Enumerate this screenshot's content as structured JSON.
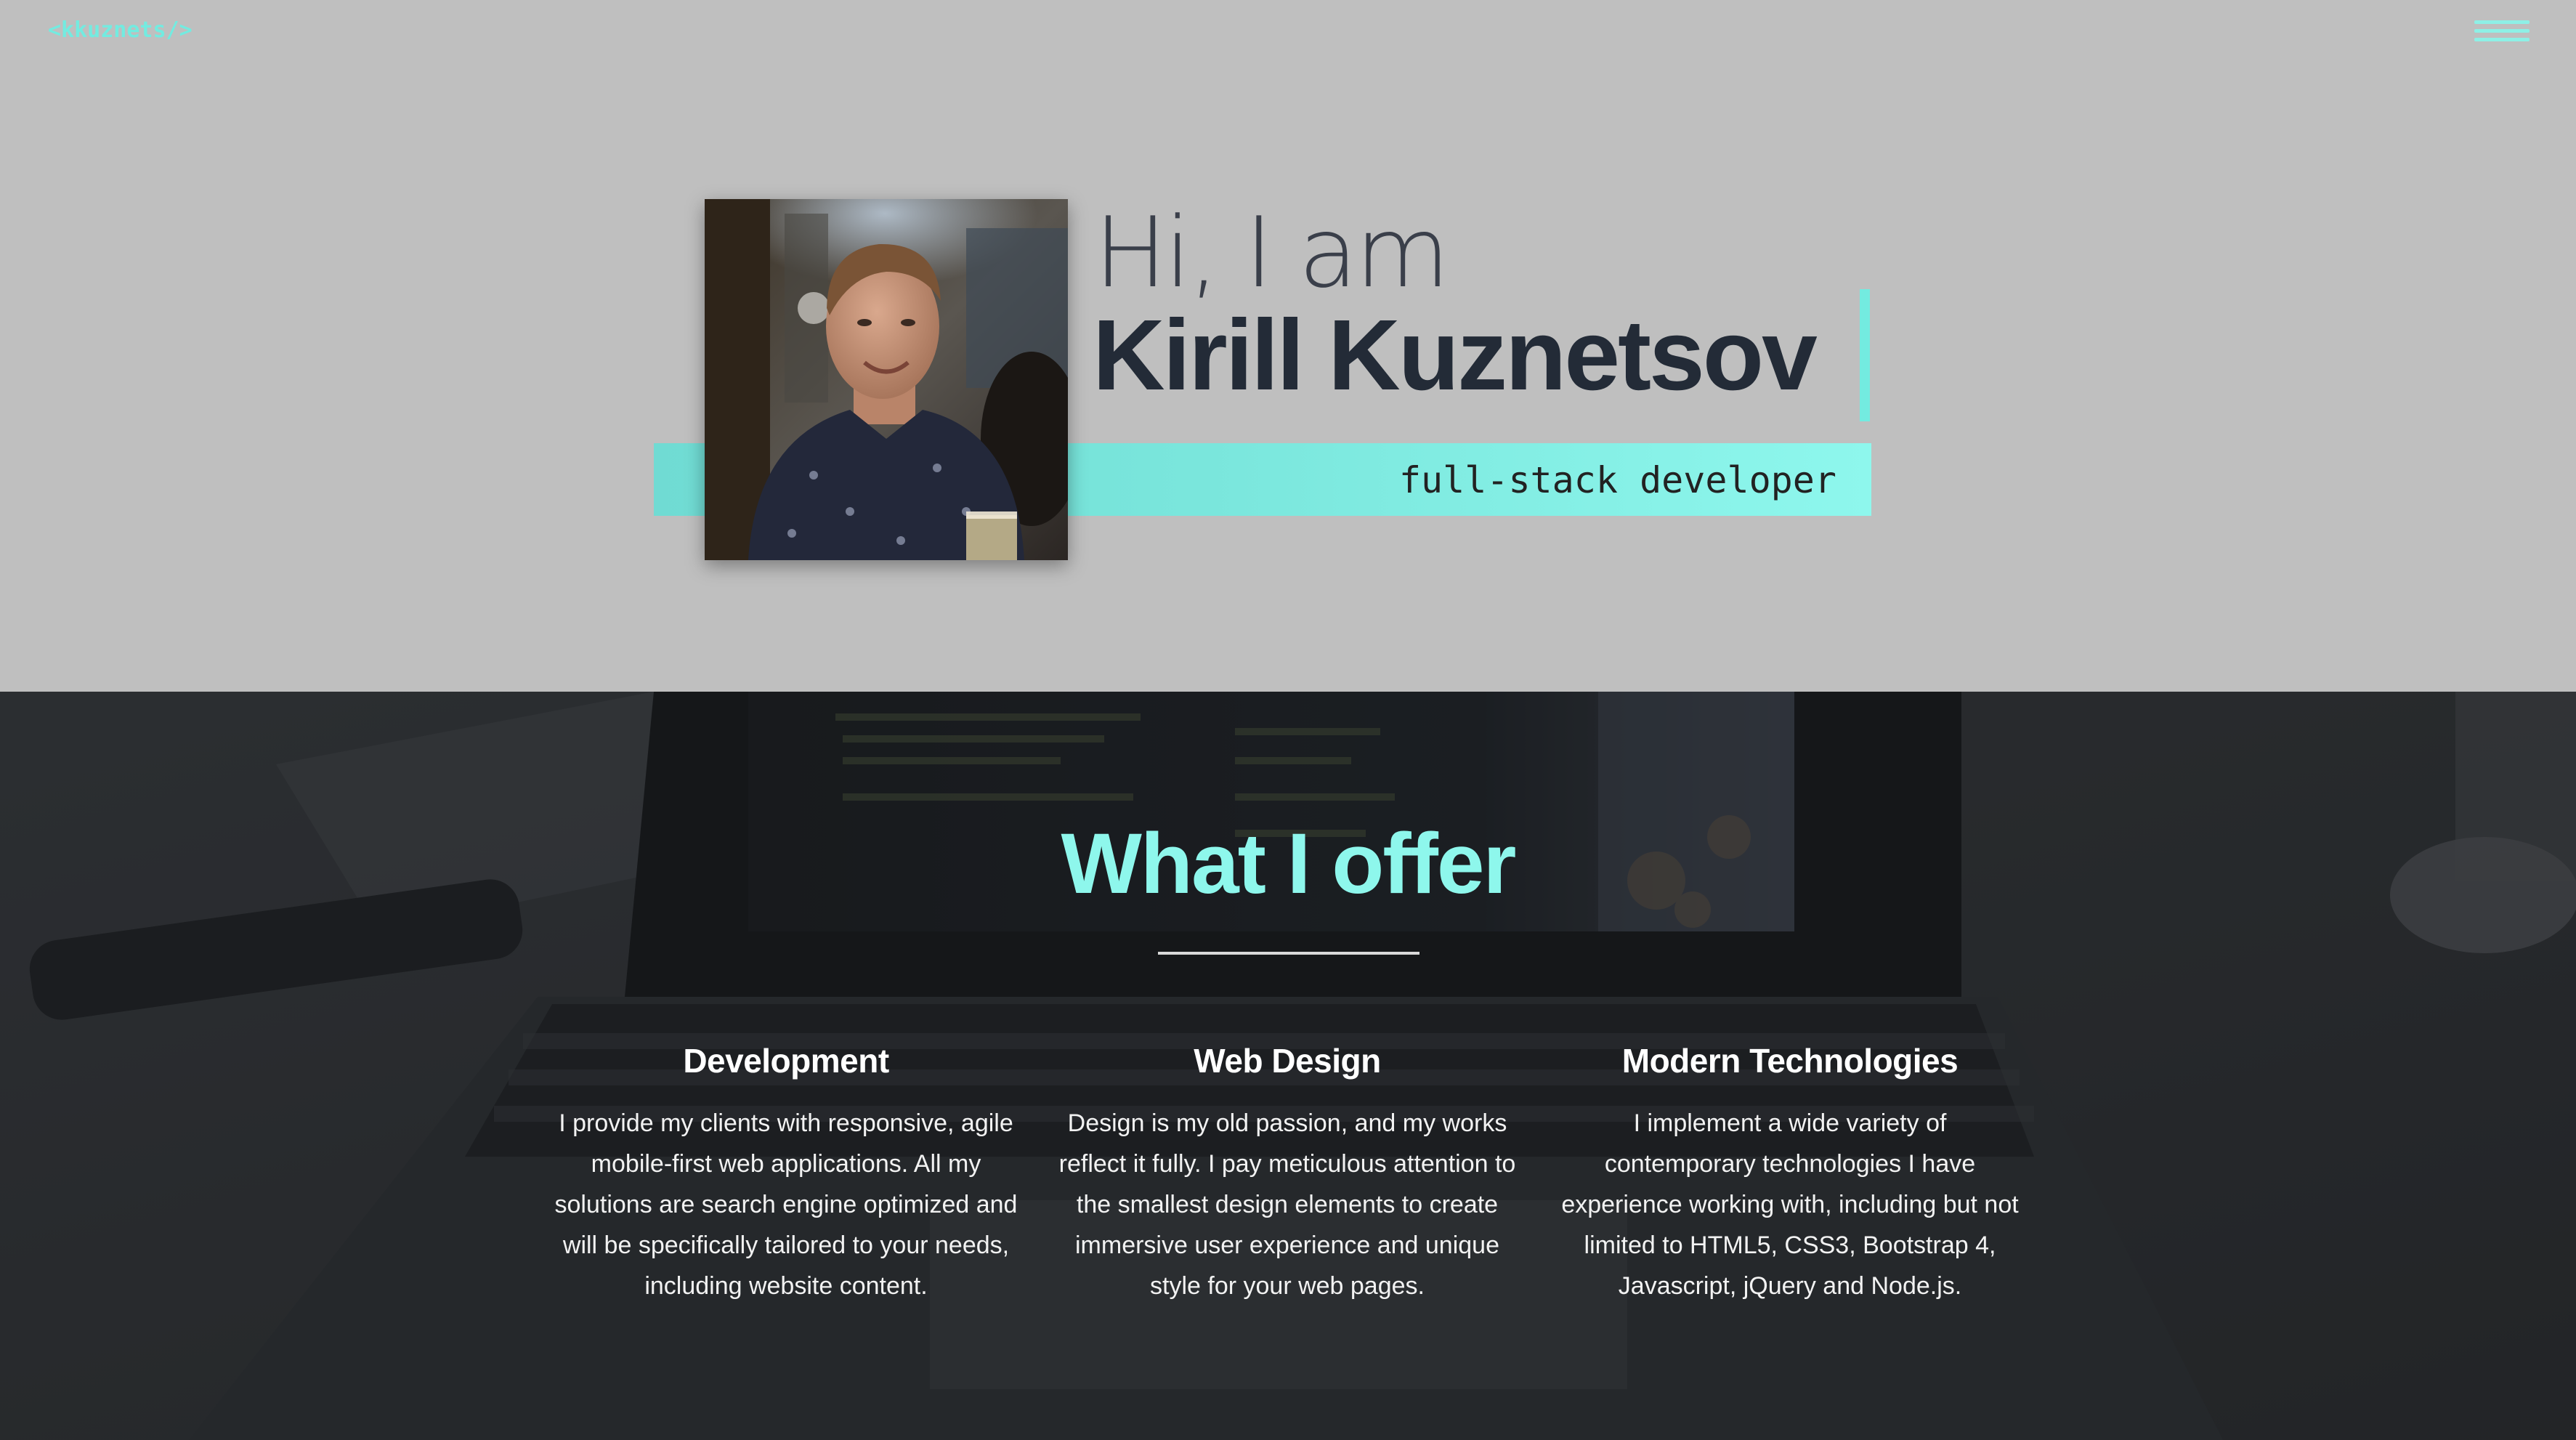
{
  "header": {
    "logo": "<kkuznets/>",
    "menu_icon": "hamburger-menu-icon"
  },
  "hero": {
    "greeting": "Hi, I am",
    "name": "Kirill Kuznetsov",
    "subtitle": "full-stack developer"
  },
  "offer": {
    "title": "What I offer",
    "columns": [
      {
        "heading": "Development",
        "text": "I provide my clients with responsive, agile mobile-first web applications. All my solutions are search engine optimized and will be specifically tailored to your needs, including website content."
      },
      {
        "heading": "Web Design",
        "text": "Design is my old passion, and my works reflect it fully. I pay meticulous attention to the smallest design elements to create immersive user experience and unique style for your web pages."
      },
      {
        "heading": "Modern Technologies",
        "text": "I implement a wide variety of contemporary technologies I have experience working with, including but not limited to HTML5, CSS3, Bootstrap 4, Javascript, jQuery and Node.js."
      }
    ]
  },
  "colors": {
    "accent": "#73ebe0",
    "hero_bg": "#bfbfbf",
    "name_text": "#232b37"
  }
}
